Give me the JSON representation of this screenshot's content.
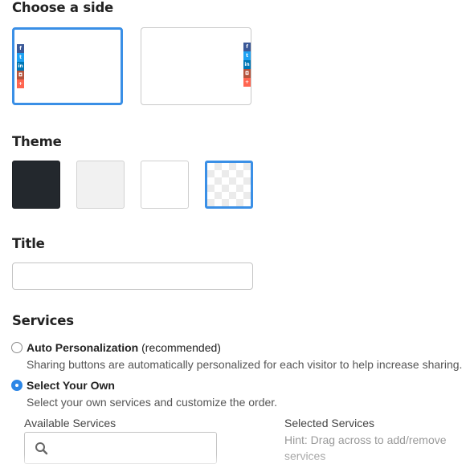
{
  "side": {
    "heading": "Choose a side",
    "options": [
      {
        "name": "left",
        "selected": true
      },
      {
        "name": "right",
        "selected": false
      }
    ],
    "icons": [
      {
        "name": "facebook-icon",
        "glyph": "f",
        "color": "#3b5998"
      },
      {
        "name": "twitter-icon",
        "glyph": "t",
        "color": "#1da1f2"
      },
      {
        "name": "linkedin-icon",
        "glyph": "in",
        "color": "#0077b5"
      },
      {
        "name": "instagram-icon",
        "glyph": "◘",
        "color": "#b5533c"
      },
      {
        "name": "more-plus-icon",
        "glyph": "+",
        "color": "#ff6550"
      }
    ]
  },
  "theme": {
    "heading": "Theme",
    "options": [
      {
        "name": "dark",
        "color": "#23282d",
        "selected": false
      },
      {
        "name": "light",
        "color": "#f1f1f1",
        "selected": false
      },
      {
        "name": "white",
        "color": "#ffffff",
        "selected": false
      },
      {
        "name": "transparent",
        "color": "checkerboard",
        "selected": true
      }
    ]
  },
  "title": {
    "heading": "Title",
    "value": "",
    "placeholder": ""
  },
  "services": {
    "heading": "Services",
    "auto": {
      "label": "Auto Personalization",
      "suffix": "(recommended)",
      "description": "Sharing buttons are automatically personalized for each visitor to help increase sharing.",
      "selected": false
    },
    "own": {
      "label": "Select Your Own",
      "description": "Select your own services and customize the order.",
      "selected": true
    },
    "available_label": "Available Services",
    "selected_label": "Selected Services",
    "hint": "Hint: Drag across to add/remove services"
  },
  "colors": {
    "accent": "#3a8fe6",
    "heading": "#222222"
  }
}
